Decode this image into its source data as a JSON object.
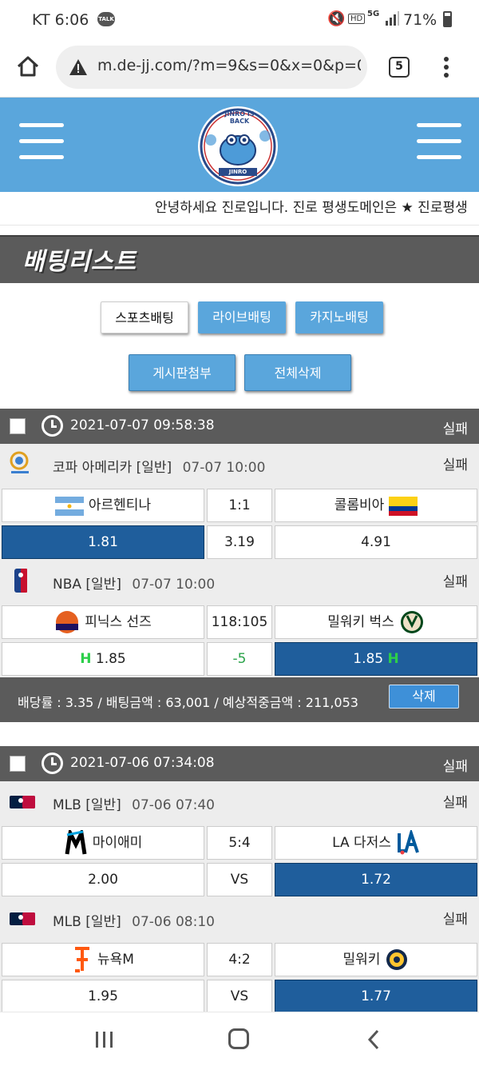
{
  "status_bar": {
    "carrier_time": "KT 6:06",
    "talk": "TALK",
    "hd": "HD",
    "net": "5G",
    "battery": "71%"
  },
  "browser": {
    "url": "m.de-jj.com/?m=9&s=0&x=0&p=0",
    "tabs_count": "5"
  },
  "header": {
    "logo_text": "JINRO IS BACK",
    "logo_sub": "JINRO"
  },
  "ticker": {
    "text": "안녕하세요 진로입니다. 진로 평생도메인은 ★ 진로평생"
  },
  "page_title": "배팅리스트",
  "tabs": [
    {
      "label": "스포츠배팅"
    },
    {
      "label": "라이브배팅"
    },
    {
      "label": "카지노배팅"
    }
  ],
  "actions": {
    "attach": "게시판첨부",
    "delete_all": "전체삭제"
  },
  "slips": [
    {
      "datetime": "2021-07-07 09:58:38",
      "status": "실패",
      "games": [
        {
          "league": "코파 아메리카 [일반]",
          "time": "07-07 10:00",
          "status": "실패",
          "home": "아르헨티나",
          "score": "1:1",
          "away": "콜롬비아",
          "odds_home": "1.81",
          "odds_mid": "3.19",
          "odds_away": "4.91",
          "selected": "home"
        },
        {
          "league": "NBA [일반]",
          "time": "07-07 10:00",
          "status": "실패",
          "home": "피닉스 선즈",
          "score": "118:105",
          "away": "밀워키 벅스",
          "odds_home": "1.85",
          "odds_mid": "-5",
          "odds_away": "1.85",
          "selected": "away",
          "handicap": true,
          "h_mark": "H"
        }
      ],
      "summary": {
        "text": "배당률 : 3.35 / 배팅금액 : 63,001 / 예상적중금액 : 211,053",
        "delete": "삭제"
      }
    },
    {
      "datetime": "2021-07-06 07:34:08",
      "status": "실패",
      "games": [
        {
          "league": "MLB [일반]",
          "time": "07-06 07:40",
          "status": "실패",
          "home": "마이애미",
          "score": "5:4",
          "away": "LA 다저스",
          "odds_home": "2.00",
          "odds_mid": "VS",
          "odds_away": "1.72",
          "selected": "away"
        },
        {
          "league": "MLB [일반]",
          "time": "07-06 08:10",
          "status": "실패",
          "home": "뉴욕M",
          "score": "4:2",
          "away": "밀워키",
          "odds_home": "1.95",
          "odds_mid": "VS",
          "odds_away": "1.77",
          "selected": "away"
        }
      ]
    }
  ],
  "colors": {
    "header_blue": "#5aa6dc",
    "selected_blue": "#1f5e9c",
    "dark_bar": "#5b5b5b"
  }
}
